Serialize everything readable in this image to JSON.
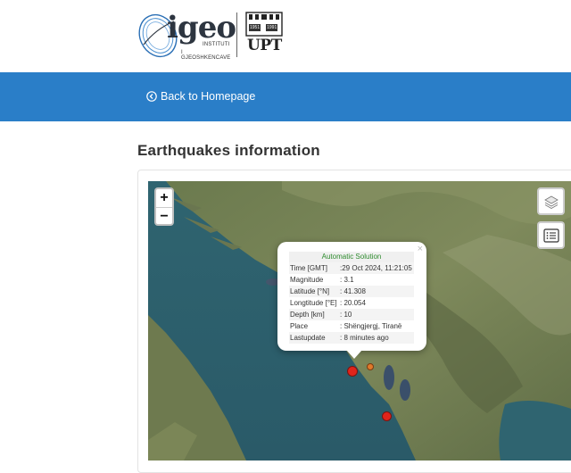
{
  "header": {
    "igeo_word": "igeo",
    "igeo_line1": "INSTITUTI",
    "igeo_line2": "I GJEOSHKENCAVE",
    "upt_text": "UPT",
    "upt_year_left": "1951",
    "upt_year_right": "1991"
  },
  "nav": {
    "back_label": "Back to Homepage"
  },
  "page": {
    "title": "Earthquakes information"
  },
  "map": {
    "zoom_in": "+",
    "zoom_out": "−",
    "layers_icon": "layers-icon",
    "list_icon": "list-icon",
    "popup": {
      "close": "×",
      "title": "Automatic Solution",
      "rows": [
        {
          "label": "Time [GMT]",
          "value": ":29 Oct 2024, 11:21:05"
        },
        {
          "label": "Magnitude",
          "value": ": 3.1"
        },
        {
          "label": "Latitude [°N]",
          "value": ": 41.308"
        },
        {
          "label": "Longtitude [°E]",
          "value": ": 20.054"
        },
        {
          "label": "Depth [km]",
          "value": ": 10"
        },
        {
          "label": "Place",
          "value": ": Shëngjergj, Tiranë"
        },
        {
          "label": "Lastupdate",
          "value": ": 8 minutes ago"
        }
      ]
    },
    "colors": {
      "quake_red": "#e0241b",
      "quake_orange": "#e07a2a",
      "nav_blue": "#2a7ec8"
    }
  }
}
